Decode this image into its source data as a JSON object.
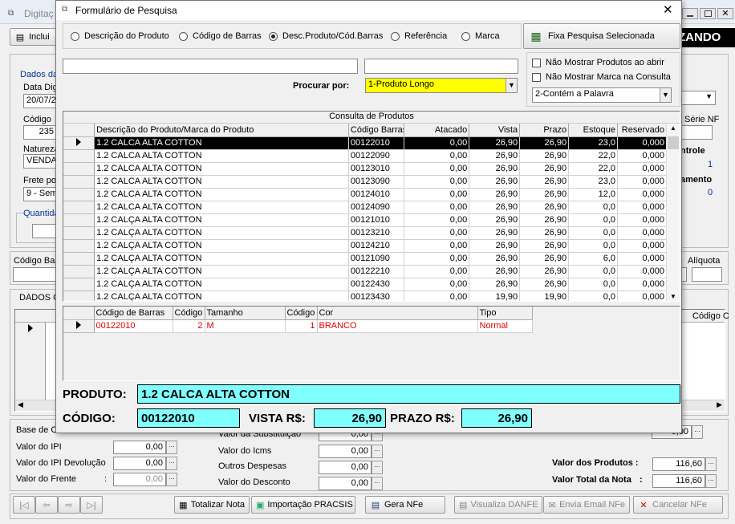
{
  "main": {
    "title": "Digitaç",
    "incluir": "Inclui",
    "zando": "ZANDO",
    "dados_label": "Dados da",
    "data_dig_label": "Data Dig",
    "data_dig_value": "20/07/2",
    "codigo_label": "Código",
    "codigo_value": "235",
    "natureza_label": "Natureza",
    "natureza_value": "VENDA",
    "frete_label": "Frete po",
    "frete_value": "9 - Sem",
    "quantidade_label": "Quantida",
    "serie_label": "Série NF",
    "controle_label": "ntrole",
    "controle_value": "1",
    "amento_label": "amento",
    "amento_value": "0",
    "codigo_barras_label": "Código Barr",
    "aliquota_label": "Alíquota",
    "dados_grid_label": "DADOS C",
    "codigo_col": "Código C",
    "base_calc_label": "Base de C",
    "valor_ipi_label": "Valor do IPI",
    "valor_ipi_value": "0,00",
    "valor_ipi_dev_label": "Valor do IPI Devolução",
    "valor_ipi_dev_value": "0,00",
    "valor_frete_label": "Valor do Frente",
    "valor_frete_value": "0,00",
    "valor_subst_label": "Valor da Substituição",
    "valor_subst_value": "0,00",
    "valor_icms_label": "Valor do Icms",
    "valor_icms_value": "0,00",
    "outras_despesas_label": "Outros Despesas",
    "outras_despesas_value": "0,00",
    "valor_desconto_label": "Valor do Desconto",
    "valor_desconto_value": "0,00",
    "base_subst_value": "0,00",
    "valor_produtos_label": "Valor dos Produtos :",
    "valor_produtos_value": "116,60",
    "valor_total_label": "Valor Total da Nota",
    "valor_total_value": "116,60",
    "totalizar": "Totalizar Nota",
    "importacao": "Importação PRACSIS",
    "gera_nfe": "Gera NFe",
    "visualiza": "Visualiza DANFE",
    "envia": "Envia Email NFe",
    "cancelar": "Cancelar NFe"
  },
  "dialog": {
    "title": "Formulário de Pesquisa",
    "radios": [
      "Descrição do Produto",
      "Código de Barras",
      "Desc.Produto/Cód.Barras",
      "Referência",
      "Marca"
    ],
    "fixa_button": "Fixa Pesquisa Selecionada",
    "procurar_label": "Procurar por:",
    "procurar_value": "1-Produto Longo",
    "check1": "Não Mostrar Produtos ao abrir",
    "check2": "Não Mostrar Marca na Consulta",
    "contem_value": "2-Contém a Palavra",
    "grid_title": "Consulta de Produtos",
    "columns": [
      "Descrição do Produto/Marca do Produto",
      "Código Barras",
      "Atacado",
      "Vista",
      "Prazo",
      "Estoque",
      "Reservado"
    ],
    "rows": [
      [
        "1.2 CALCA ALTA COTTON",
        "00122010",
        "0,00",
        "26,90",
        "26,90",
        "23,0",
        "0,000"
      ],
      [
        "1.2 CALCA ALTA COTTON",
        "00122090",
        "0,00",
        "26,90",
        "26,90",
        "22,0",
        "0,000"
      ],
      [
        "1.2 CALCA ALTA COTTON",
        "00123010",
        "0,00",
        "26,90",
        "26,90",
        "22,0",
        "0,000"
      ],
      [
        "1.2 CALCA ALTA COTTON",
        "00123090",
        "0,00",
        "26,90",
        "26,90",
        "23,0",
        "0,000"
      ],
      [
        "1.2 CALCA ALTA COTTON",
        "00124010",
        "0,00",
        "26,90",
        "26,90",
        "12,0",
        "0,000"
      ],
      [
        "1.2 CALCA ALTA COTTON",
        "00124090",
        "0,00",
        "26,90",
        "26,90",
        "0,0",
        "0,000"
      ],
      [
        "1.2 CALÇA ALTA COTTON",
        "00121010",
        "0,00",
        "26,90",
        "26,90",
        "0,0",
        "0,000"
      ],
      [
        "1.2 CALÇA ALTA COTTON",
        "00123210",
        "0,00",
        "26,90",
        "26,90",
        "0,0",
        "0,000"
      ],
      [
        "1.2 CALÇA ALTA COTTON",
        "00124210",
        "0,00",
        "26,90",
        "26,90",
        "0,0",
        "0,000"
      ],
      [
        "1.2 CALÇA ALTA COTTON",
        "00121090",
        "0,00",
        "26,90",
        "26,90",
        "6,0",
        "0,000"
      ],
      [
        "1.2 CALÇA ALTA COTTON",
        "00122210",
        "0,00",
        "26,90",
        "26,90",
        "0,0",
        "0,000"
      ],
      [
        "1.2 CALÇA ALTA COTTON",
        "00122430",
        "0,00",
        "26,90",
        "26,90",
        "0,0",
        "0,000"
      ],
      [
        "1.2 CALÇA ALTA COTTON",
        "00123430",
        "0,00",
        "19,90",
        "19,90",
        "0,0",
        "0,000"
      ]
    ],
    "sub_columns": [
      "Código de Barras",
      "Código",
      "Tamanho",
      "Código",
      "Cor",
      "Tipo"
    ],
    "sub_row": [
      "00122010",
      "2",
      "M",
      "1",
      "BRANCO",
      "Normal"
    ],
    "produto_label": "PRODUTO:",
    "produto_value": "1.2 CALCA ALTA COTTON",
    "codigo_label": "CÓDIGO:",
    "codigo_value": "00122010",
    "vista_label": "VISTA R$:",
    "vista_value": "26,90",
    "prazo_label": "PRAZO R$:",
    "prazo_value": "26,90"
  }
}
